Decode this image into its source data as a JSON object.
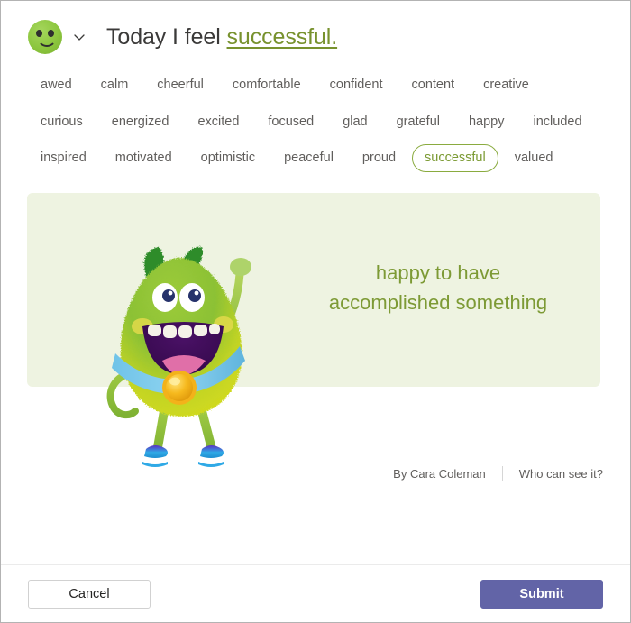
{
  "dialog": {
    "avatar_icon": "green-smiley-emoji",
    "chevron_icon": "chevron-down-icon",
    "headline_prefix": "Today I feel",
    "headline_feeling": "successful."
  },
  "feelings": {
    "rows": [
      [
        "awed",
        "calm",
        "cheerful",
        "comfortable",
        "confident",
        "content",
        "creative",
        "curious"
      ],
      [
        "energized",
        "excited",
        "focused",
        "glad",
        "grateful",
        "happy",
        "included",
        "inspired"
      ],
      [
        "motivated",
        "optimistic",
        "peaceful",
        "proud",
        "successful",
        "valued"
      ]
    ],
    "selected": "successful",
    "selected_color": "#7b9a33",
    "unselected_color": "#605e5c"
  },
  "banner": {
    "background_color": "#eef3e1",
    "caption_line1": "happy to have",
    "caption_line2": "accomplished something",
    "caption_color": "#7d9a35",
    "illustration_name": "green-furry-monster-with-medal"
  },
  "byline": {
    "author": "By Cara Coleman",
    "visibility_link": "Who can see it?"
  },
  "footer": {
    "cancel_label": "Cancel",
    "submit_label": "Submit",
    "submit_color": "#6264a7"
  }
}
